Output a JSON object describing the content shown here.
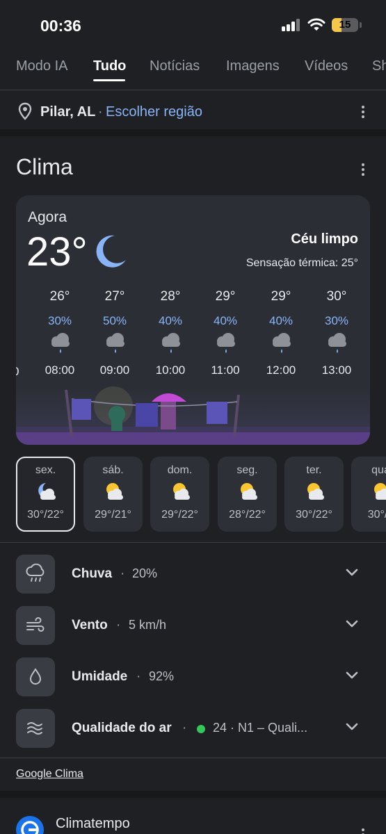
{
  "status": {
    "time": "00:36",
    "battery": "15"
  },
  "tabs": [
    {
      "label": "Modo IA"
    },
    {
      "label": "Tudo"
    },
    {
      "label": "Notícias"
    },
    {
      "label": "Imagens"
    },
    {
      "label": "Vídeos"
    },
    {
      "label": "Sh"
    }
  ],
  "location": {
    "name": "Pilar, AL",
    "separator": "·",
    "change_link": "Escolher região"
  },
  "weather": {
    "title": "Clima",
    "now_label": "Agora",
    "temp": "23°",
    "condition": "Céu limpo",
    "feels_like": "Sensação térmica: 25°",
    "edge_label": "0",
    "hourly": [
      {
        "temp": "26°",
        "precip": "30%",
        "time": "08:00",
        "icon": "rain-cloud-icon"
      },
      {
        "temp": "27°",
        "precip": "50%",
        "time": "09:00",
        "icon": "rain-cloud-icon"
      },
      {
        "temp": "28°",
        "precip": "40%",
        "time": "10:00",
        "icon": "rain-cloud-icon"
      },
      {
        "temp": "29°",
        "precip": "40%",
        "time": "11:00",
        "icon": "rain-cloud-icon"
      },
      {
        "temp": "29°",
        "precip": "40%",
        "time": "12:00",
        "icon": "rain-cloud-icon"
      },
      {
        "temp": "30°",
        "precip": "30%",
        "time": "13:00",
        "icon": "rain-cloud-icon"
      }
    ],
    "daily": [
      {
        "day": "sex.",
        "range": "30°/22°",
        "icon": "moon-cloud-icon",
        "selected": true
      },
      {
        "day": "sáb.",
        "range": "29°/21°",
        "icon": "sun-cloud-icon"
      },
      {
        "day": "dom.",
        "range": "29°/22°",
        "icon": "sun-cloud-icon"
      },
      {
        "day": "seg.",
        "range": "28°/22°",
        "icon": "sun-cloud-icon"
      },
      {
        "day": "ter.",
        "range": "30°/22°",
        "icon": "sun-cloud-icon"
      },
      {
        "day": "qua",
        "range": "30°/2",
        "icon": "sun-cloud-icon"
      }
    ],
    "details": [
      {
        "label": "Chuva",
        "dot": "·",
        "value": "20%",
        "icon": "rain-icon"
      },
      {
        "label": "Vento",
        "dot": "·",
        "value": "5 km/h",
        "icon": "wind-icon"
      },
      {
        "label": "Umidade",
        "dot": "·",
        "value": "92%",
        "icon": "droplet-icon"
      },
      {
        "label": "Qualidade do ar",
        "dot": "·",
        "value": "24 · N1 – Quali...",
        "icon": "air-quality-icon",
        "status_color": "#34c759"
      }
    ],
    "source": "Google Clima"
  },
  "next_result": {
    "title": "Climatempo"
  },
  "colors": {
    "accent_link": "#8ab4f8",
    "precip": "#8ab4f8",
    "air_good": "#34c759",
    "moon": "#8ab4f8",
    "sun": "#f9c530"
  }
}
